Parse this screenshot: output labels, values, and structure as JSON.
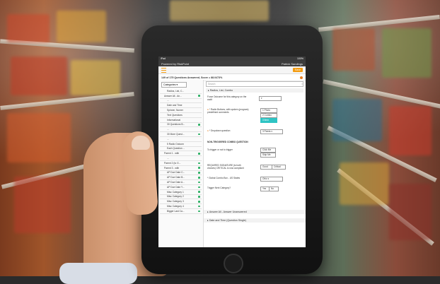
{
  "app": {
    "carrier": "iPad",
    "battery": "100%",
    "brand": "Powered by RiskPoint",
    "user": "Patrick Sandings",
    "save_label": "Save",
    "progress": "149 of 175 Questions Answered, Score = 88.0473%"
  },
  "left_panel": {
    "categories_label": "Categories",
    "items": [
      {
        "label": "Radios, List, C...",
        "done": false,
        "sub": true
      },
      {
        "label": "Answer All - An...",
        "done": true,
        "sub": false
      },
      {
        "label": "...",
        "done": false,
        "sub": true
      },
      {
        "label": "Date and Time",
        "done": false,
        "sub": true
      },
      {
        "label": "Spinner, Numer",
        "done": false,
        "sub": true
      },
      {
        "label": "Text Questions",
        "done": false,
        "sub": true
      },
      {
        "label": "Informational",
        "done": false,
        "sub": true
      },
      {
        "label": "30 Questions B...",
        "done": true,
        "sub": true
      },
      {
        "label": "...",
        "done": false,
        "sub": true
      },
      {
        "label": "30 More Quest...",
        "done": true,
        "sub": true
      },
      {
        "label": "...",
        "done": false,
        "sub": true
      },
      {
        "label": "5 Radio Outcom",
        "done": false,
        "sub": true
      },
      {
        "label": "Each Question ...",
        "done": false,
        "sub": true
      },
      {
        "label": "Parent 1 - with",
        "done": true,
        "sub": false
      },
      {
        "label": "...",
        "done": false,
        "sub": true
      },
      {
        "label": "Parent 2 (to G...",
        "done": true,
        "sub": false
      },
      {
        "label": "Parent 3 - with",
        "done": true,
        "sub": false
      },
      {
        "label": "AP Due Date C...",
        "done": true,
        "sub": true
      },
      {
        "label": "AP Due Date B...",
        "done": true,
        "sub": true
      },
      {
        "label": "AP Due Date A...",
        "done": true,
        "sub": true
      },
      {
        "label": "AP Due Date Y...",
        "done": true,
        "sub": true
      },
      {
        "label": "Misc Category 1",
        "done": true,
        "sub": true
      },
      {
        "label": "Misc Category 2",
        "done": true,
        "sub": true
      },
      {
        "label": "Misc Category 3",
        "done": true,
        "sub": true
      },
      {
        "label": "Misc Category 4",
        "done": true,
        "sub": true
      },
      {
        "label": "Bigger Last Ca...",
        "done": true,
        "sub": true
      }
    ]
  },
  "main": {
    "search_placeholder": "Search",
    "section_title": "Radios, List, Combo",
    "questions": {
      "q1": "Force Outcome for this category on the audit",
      "q2": "* Radio Buttons, with spoken (program) predefined comments",
      "q2_options": [
        "1 Photo",
        "2 Combo",
        "3 Item"
      ],
      "q3": "* Dropdown question",
      "q3_value": "3 Points",
      "note": "NON-TRIGGERED COMBO QUESTION",
      "q4": "To trigger or not to trigger",
      "q4_options": [
        "Click Me",
        "Skip Me"
      ],
      "q5": "REQUIRED SIGNATURE (to both choices) CRITICAL is now compliant",
      "q5_options": [
        "Good",
        "Critical"
      ],
      "q6": "* Global Combo Box - US States",
      "q6_value": "Ohio",
      "q7": "Trigger Next Category?",
      "q7_options": [
        "Yes",
        "No"
      ]
    },
    "section2_title": "Answer All - Answer Unanswered",
    "section3_title": "Date and Time (Question Single)"
  }
}
